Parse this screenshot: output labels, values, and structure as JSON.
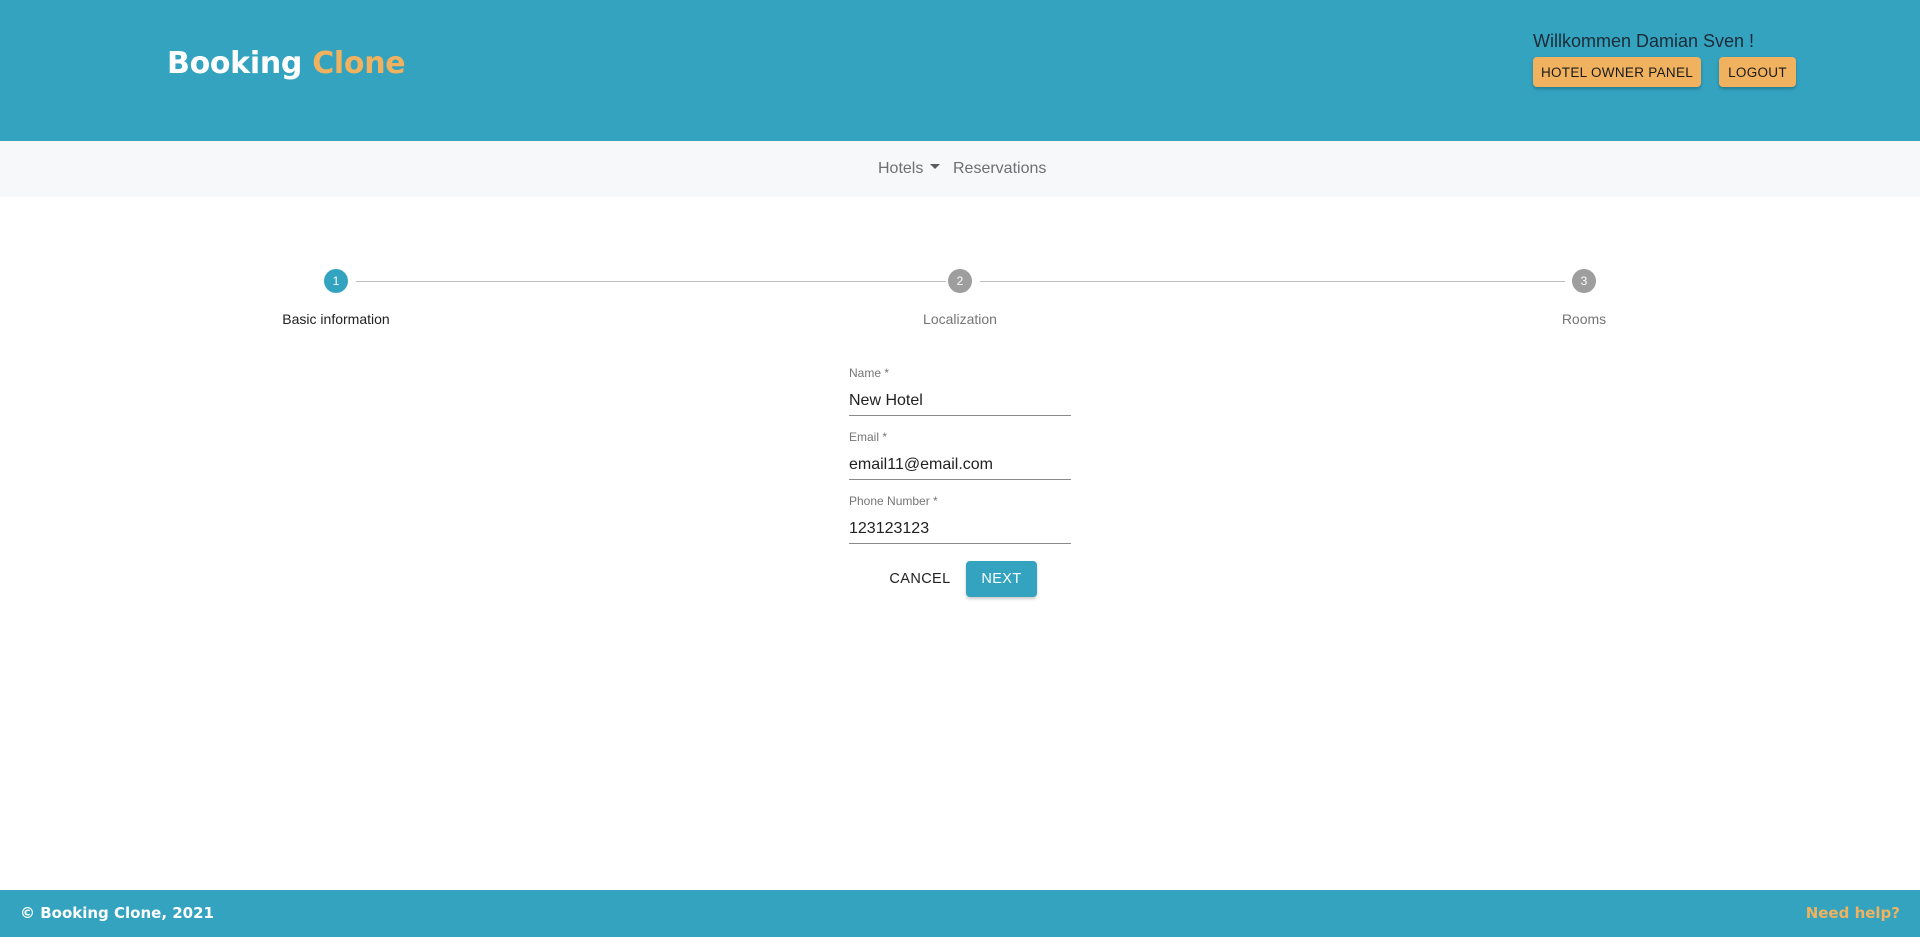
{
  "header": {
    "brand_main": "Booking",
    "brand_accent": "Clone",
    "welcome": "Willkommen Damian Sven !",
    "owner_panel_label": "HOTEL OWNER PANEL",
    "logout_label": "LOGOUT"
  },
  "nav": {
    "hotels_label": "Hotels",
    "reservations_label": "Reservations"
  },
  "stepper": {
    "steps": [
      {
        "number": "1",
        "label": "Basic information",
        "state": "active"
      },
      {
        "number": "2",
        "label": "Localization",
        "state": "inactive"
      },
      {
        "number": "3",
        "label": "Rooms",
        "state": "inactive"
      }
    ]
  },
  "form": {
    "name": {
      "label": "Name *",
      "value": "New Hotel"
    },
    "email": {
      "label": "Email *",
      "value": "email11@email.com"
    },
    "phone": {
      "label": "Phone Number *",
      "value": "123123123"
    },
    "cancel_label": "CANCEL",
    "next_label": "NEXT"
  },
  "footer": {
    "copyright": "© Booking Clone, 2021",
    "help_label": "Need help?"
  },
  "colors": {
    "primary": "#33a3c0",
    "accent": "#f0b25e",
    "inactive_step": "#9e9e9e",
    "nav_bg": "#f7f8fa"
  }
}
